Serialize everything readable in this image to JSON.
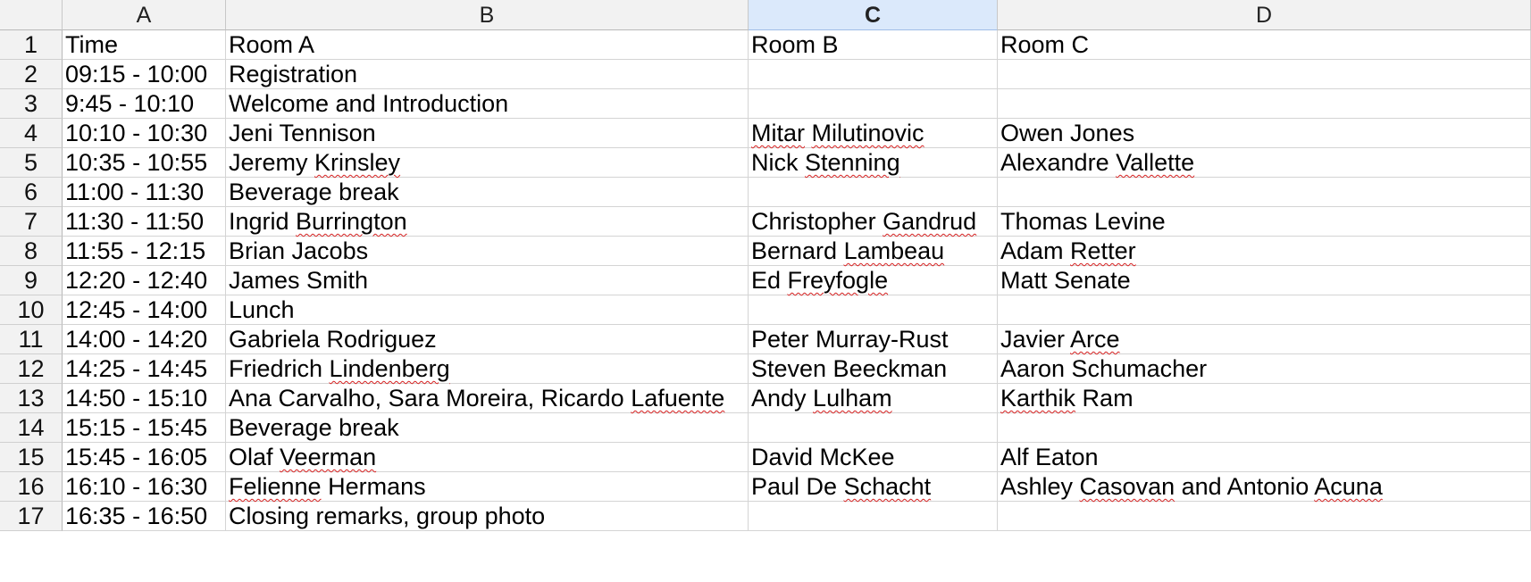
{
  "columns": [
    "A",
    "B",
    "C",
    "D"
  ],
  "selected_column": "C",
  "colors": {
    "header_bg": "#f2f2f2",
    "selected_header_bg": "#dbe9fb",
    "gridline": "#d4d4d4",
    "spell_underline": "#d62020"
  },
  "rows": [
    {
      "num": "1",
      "cells": [
        [
          {
            "t": "Time"
          }
        ],
        [
          {
            "t": "Room A"
          }
        ],
        [
          {
            "t": "Room B"
          }
        ],
        [
          {
            "t": "Room C"
          }
        ]
      ]
    },
    {
      "num": "2",
      "cells": [
        [
          {
            "t": "09:15 - 10:00"
          }
        ],
        [
          {
            "t": "Registration"
          }
        ],
        [],
        []
      ]
    },
    {
      "num": "3",
      "cells": [
        [
          {
            "t": "9:45 - 10:10"
          }
        ],
        [
          {
            "t": "Welcome and Introduction"
          }
        ],
        [],
        []
      ]
    },
    {
      "num": "4",
      "cells": [
        [
          {
            "t": "10:10 - 10:30"
          }
        ],
        [
          {
            "t": "Jeni Tennison"
          }
        ],
        [
          {
            "t": "Mitar",
            "sp": true
          },
          {
            "t": " "
          },
          {
            "t": "Milutinovic",
            "sp": true
          }
        ],
        [
          {
            "t": "Owen Jones"
          }
        ]
      ]
    },
    {
      "num": "5",
      "cells": [
        [
          {
            "t": "10:35 - 10:55"
          }
        ],
        [
          {
            "t": "Jeremy "
          },
          {
            "t": "Krinsley",
            "sp": true
          }
        ],
        [
          {
            "t": "Nick "
          },
          {
            "t": "Stenning",
            "sp": true
          }
        ],
        [
          {
            "t": "Alexandre "
          },
          {
            "t": "Vallette",
            "sp": true
          }
        ]
      ]
    },
    {
      "num": "6",
      "cells": [
        [
          {
            "t": "11:00 - 11:30"
          }
        ],
        [
          {
            "t": "Beverage break"
          }
        ],
        [],
        []
      ]
    },
    {
      "num": "7",
      "cells": [
        [
          {
            "t": "11:30 - 11:50"
          }
        ],
        [
          {
            "t": "Ingrid "
          },
          {
            "t": "Burrington",
            "sp": true
          }
        ],
        [
          {
            "t": "Christopher "
          },
          {
            "t": "Gandrud",
            "sp": true
          }
        ],
        [
          {
            "t": "Thomas Levine"
          }
        ]
      ]
    },
    {
      "num": "8",
      "cells": [
        [
          {
            "t": "11:55 - 12:15"
          }
        ],
        [
          {
            "t": "Brian Jacobs"
          }
        ],
        [
          {
            "t": "Bernard "
          },
          {
            "t": "Lambeau",
            "sp": true
          }
        ],
        [
          {
            "t": "Adam "
          },
          {
            "t": "Retter",
            "sp": true
          }
        ]
      ]
    },
    {
      "num": "9",
      "cells": [
        [
          {
            "t": "12:20 - 12:40"
          }
        ],
        [
          {
            "t": "James Smith"
          }
        ],
        [
          {
            "t": "Ed "
          },
          {
            "t": "Freyfogle",
            "sp": true
          }
        ],
        [
          {
            "t": "Matt Senate"
          }
        ]
      ]
    },
    {
      "num": "10",
      "cells": [
        [
          {
            "t": "12:45 - 14:00"
          }
        ],
        [
          {
            "t": "Lunch"
          }
        ],
        [],
        []
      ]
    },
    {
      "num": "11",
      "cells": [
        [
          {
            "t": "14:00 - 14:20"
          }
        ],
        [
          {
            "t": "Gabriela Rodriguez"
          }
        ],
        [
          {
            "t": "Peter Murray-Rust"
          }
        ],
        [
          {
            "t": "Javier "
          },
          {
            "t": "Arce",
            "sp": true
          }
        ]
      ]
    },
    {
      "num": "12",
      "cells": [
        [
          {
            "t": "14:25 - 14:45"
          }
        ],
        [
          {
            "t": "Friedrich "
          },
          {
            "t": "Lindenberg",
            "sp": true
          }
        ],
        [
          {
            "t": "Steven Beeckman"
          }
        ],
        [
          {
            "t": "Aaron Schumacher"
          }
        ]
      ]
    },
    {
      "num": "13",
      "cells": [
        [
          {
            "t": "14:50 - 15:10"
          }
        ],
        [
          {
            "t": "Ana Carvalho, Sara Moreira, Ricardo "
          },
          {
            "t": "Lafuente",
            "sp": true
          }
        ],
        [
          {
            "t": "Andy "
          },
          {
            "t": "Lulham",
            "sp": true
          }
        ],
        [
          {
            "t": "Karthik",
            "sp": true
          },
          {
            "t": " Ram"
          }
        ]
      ]
    },
    {
      "num": "14",
      "cells": [
        [
          {
            "t": "15:15 - 15:45"
          }
        ],
        [
          {
            "t": "Beverage break"
          }
        ],
        [],
        []
      ]
    },
    {
      "num": "15",
      "cells": [
        [
          {
            "t": "15:45 - 16:05"
          }
        ],
        [
          {
            "t": "Olaf "
          },
          {
            "t": "Veerman",
            "sp": true
          }
        ],
        [
          {
            "t": "David McKee"
          }
        ],
        [
          {
            "t": "Alf Eaton"
          }
        ]
      ]
    },
    {
      "num": "16",
      "cells": [
        [
          {
            "t": "16:10 - 16:30"
          }
        ],
        [
          {
            "t": "Felienne",
            "sp": true
          },
          {
            "t": " Hermans"
          }
        ],
        [
          {
            "t": "Paul De "
          },
          {
            "t": "Schacht",
            "sp": true
          }
        ],
        [
          {
            "t": "Ashley "
          },
          {
            "t": "Casovan",
            "sp": true
          },
          {
            "t": " and Antonio "
          },
          {
            "t": "Acuna",
            "sp": true
          }
        ]
      ]
    },
    {
      "num": "17",
      "cells": [
        [
          {
            "t": "16:35 - 16:50"
          }
        ],
        [
          {
            "t": "Closing remarks, group photo"
          }
        ],
        [],
        []
      ]
    }
  ]
}
